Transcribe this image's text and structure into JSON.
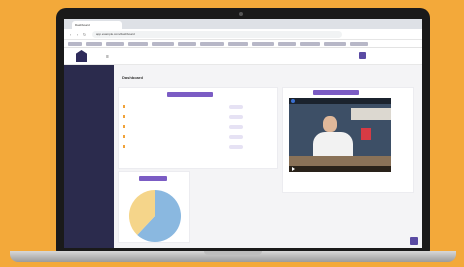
{
  "browser": {
    "tab_title": "Dashboard",
    "url": "app.example.com/dashboard"
  },
  "header": {
    "menu_icon": "hamburger-icon",
    "notice": "",
    "username": ""
  },
  "sidebar": {
    "items": [
      {
        "label": ""
      },
      {
        "label": ""
      },
      {
        "label": ""
      },
      {
        "label": ""
      },
      {
        "label": ""
      },
      {
        "label": ""
      },
      {
        "label": ""
      },
      {
        "label": ""
      },
      {
        "label": ""
      },
      {
        "label": ""
      },
      {
        "label": ""
      },
      {
        "label": ""
      },
      {
        "label": ""
      },
      {
        "label": ""
      },
      {
        "label": ""
      }
    ]
  },
  "main": {
    "title": "Dashboard",
    "breadcrumb": "",
    "list_card": {
      "header": "",
      "rows": [
        {
          "label": "",
          "pill": ""
        },
        {
          "label": "",
          "pill": ""
        },
        {
          "label": "",
          "pill": ""
        },
        {
          "label": "",
          "pill": ""
        },
        {
          "label": "",
          "pill": ""
        }
      ]
    },
    "video_card": {
      "header": "",
      "video_title": ""
    },
    "chart_card": {
      "header": ""
    }
  },
  "colors": {
    "background": "#f3a93a",
    "sidebar": "#2b2b4d",
    "accent": "#7b5cc4",
    "pie_series_1": "#8ab8e0",
    "pie_series_2": "#f5d58a"
  },
  "chart_data": {
    "type": "pie",
    "title": "",
    "categories": [
      "",
      ""
    ],
    "values": [
      62,
      38
    ]
  }
}
